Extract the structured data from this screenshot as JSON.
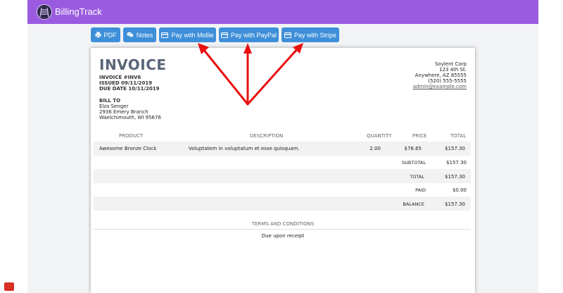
{
  "app": {
    "brand": "BillingTrack"
  },
  "toolbar": {
    "pdf": "PDF",
    "notes": "Notes",
    "mollie": "Pay with Mollie",
    "paypal": "Pay with PayPal",
    "stripe": "Pay with Stripe"
  },
  "invoice": {
    "title": "INVOICE",
    "number": "INVOICE #INV6",
    "issued": "ISSUED 09/11/2019",
    "due": "DUE DATE 10/11/2019",
    "bill_to_label": "BILL TO",
    "customer": {
      "name": "Elza Senger",
      "street": "2936 Emery Branch",
      "city": "Waelchimouth, WI 95676"
    },
    "company": {
      "name": "Soylent Corp",
      "street": "123 4th St.",
      "city": "Anywhere, AZ 85555",
      "phone": "(520) 555-5555",
      "email": "admin@example.com"
    },
    "columns": {
      "product": "PRODUCT",
      "description": "DESCRIPTION",
      "quantity": "QUANTITY",
      "price": "PRICE",
      "total": "TOTAL"
    },
    "items": [
      {
        "product": "Awesome Bronze Clock",
        "description": "Voluptatem in voluptatum et esse quisquam.",
        "quantity": "2.00",
        "price": "$78.65",
        "total": "$157.30"
      }
    ],
    "totals": {
      "subtotal_label": "SUBTOTAL",
      "subtotal": "$157.30",
      "total_label": "TOTAL",
      "total": "$157.30",
      "paid_label": "PAID",
      "paid": "$0.00",
      "balance_label": "BALANCE",
      "balance": "$157.30"
    },
    "terms_label": "TERMS AND CONDITIONS",
    "terms": "Due upon receipt"
  },
  "colors": {
    "navbar": "#9a5be0",
    "button": "#3e8fd9",
    "arrow": "#e81010",
    "title": "#596577"
  }
}
